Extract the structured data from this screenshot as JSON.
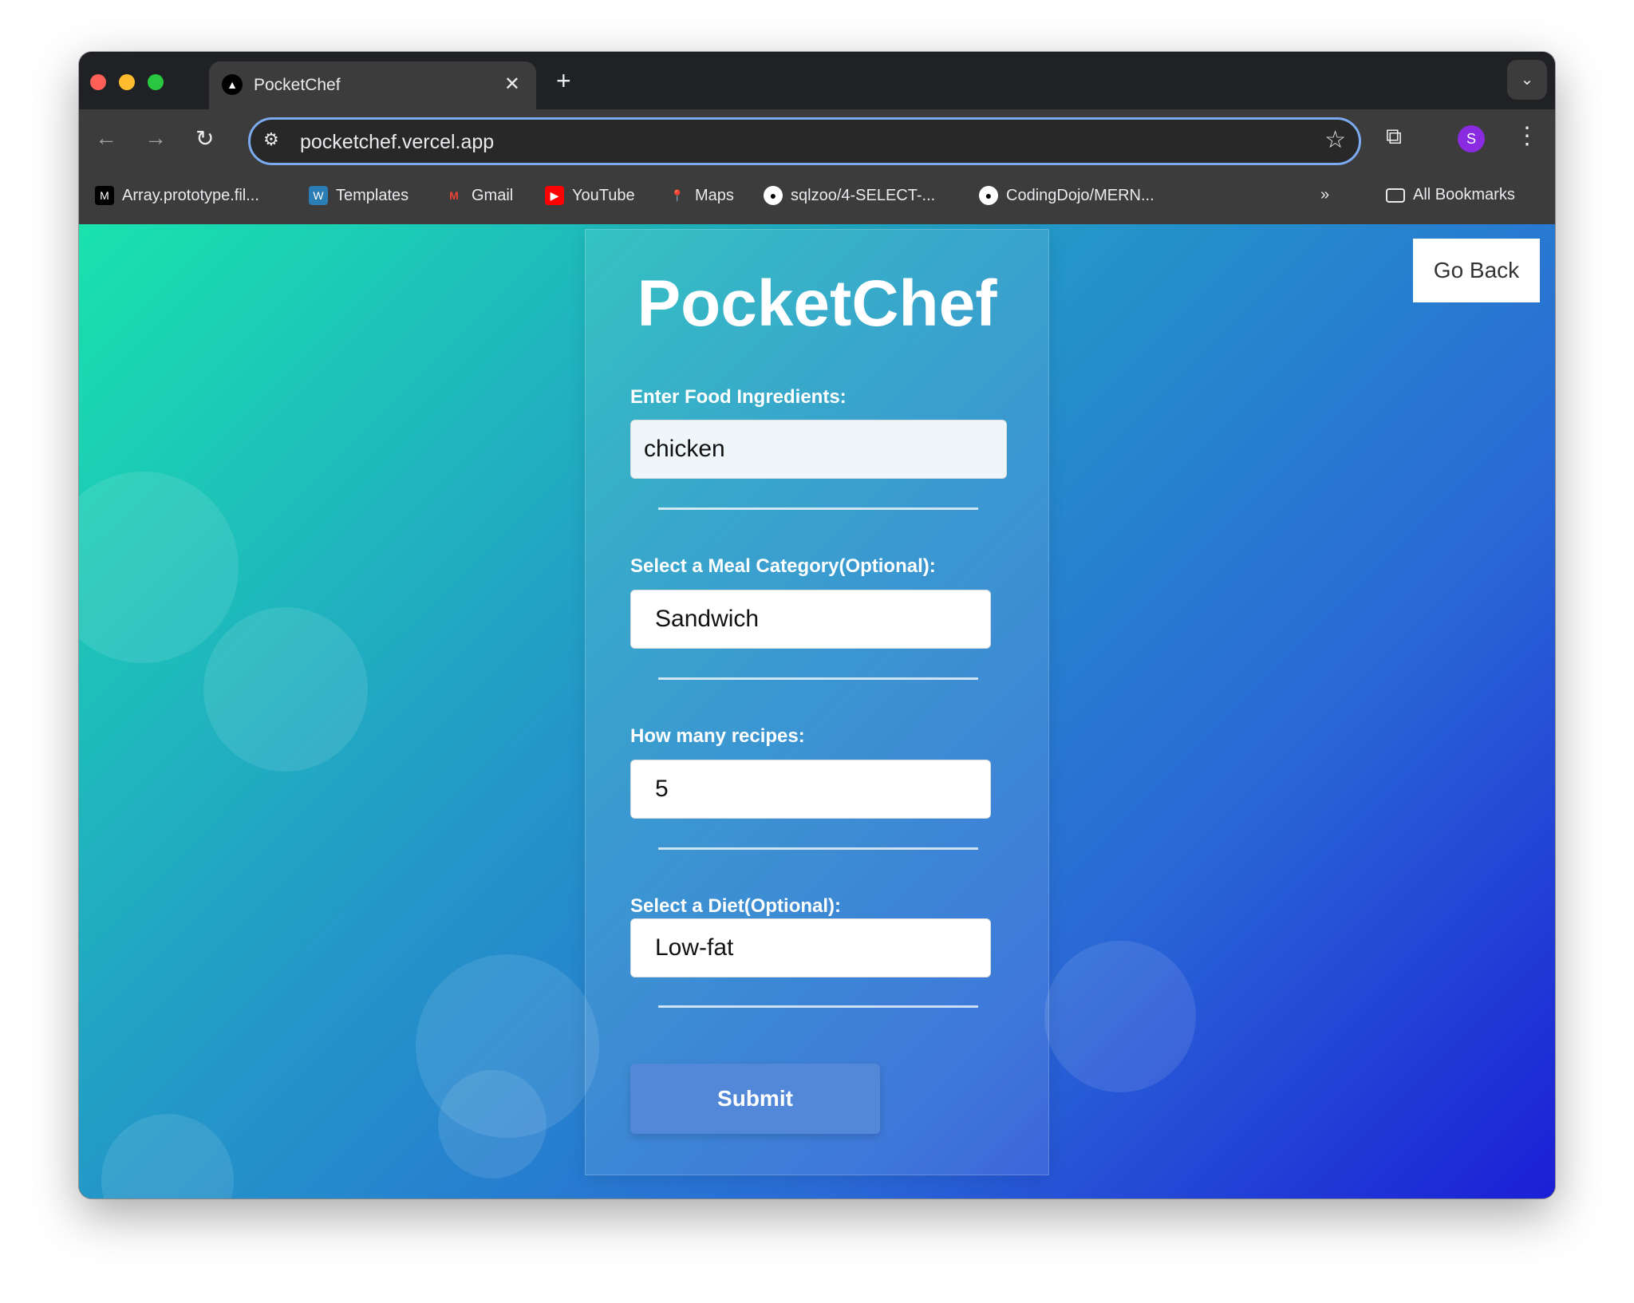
{
  "browser": {
    "tab_title": "PocketChef",
    "url": "pocketchef.vercel.app",
    "profile_initial": "S",
    "bookmarks": [
      {
        "label": "Array.prototype.fil...",
        "icon": "mdn-icon"
      },
      {
        "label": "Templates",
        "icon": "wordpress-icon"
      },
      {
        "label": "Gmail",
        "icon": "gmail-icon"
      },
      {
        "label": "YouTube",
        "icon": "youtube-icon"
      },
      {
        "label": "Maps",
        "icon": "maps-icon"
      },
      {
        "label": "sqlzoo/4-SELECT-...",
        "icon": "github-icon"
      },
      {
        "label": "CodingDojo/MERN...",
        "icon": "github-icon"
      }
    ],
    "all_bookmarks": "All Bookmarks"
  },
  "page": {
    "go_back": "Go Back",
    "title": "PocketChef",
    "ingredients_label": "Enter Food Ingredients:",
    "ingredients_value": "chicken",
    "category_label": "Select a Meal Category(Optional):",
    "category_value": "Sandwich",
    "count_label": "How many recipes:",
    "count_value": "5",
    "diet_label": "Select a Diet(Optional):",
    "diet_value": "Low-fat",
    "submit": "Submit"
  },
  "colors": {
    "accent": "#5388d8",
    "gradient_start": "#19e3ad",
    "gradient_end": "#1b1fd6"
  }
}
